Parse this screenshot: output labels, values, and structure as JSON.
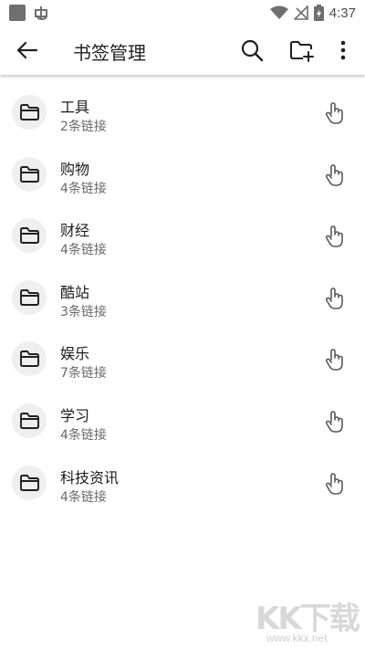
{
  "status_bar": {
    "time": "4:37"
  },
  "app_bar": {
    "title": "书签管理"
  },
  "folders": [
    {
      "name": "工具",
      "count": "2条链接"
    },
    {
      "name": "购物",
      "count": "4条链接"
    },
    {
      "name": "财经",
      "count": "4条链接"
    },
    {
      "name": "酷站",
      "count": "3条链接"
    },
    {
      "name": "娱乐",
      "count": "7条链接"
    },
    {
      "name": "学习",
      "count": "4条链接"
    },
    {
      "name": "科技资讯",
      "count": "4条链接"
    }
  ],
  "icons": {
    "back": "arrow-left-icon",
    "search": "search-icon",
    "new_folder": "folder-add-icon",
    "more": "more-vert-icon",
    "folder": "folder-icon",
    "open": "touch-hand-icon"
  },
  "watermark": {
    "brand": "KK下载",
    "url": "www.kkx.net"
  },
  "colors": {
    "background": "#ffffff",
    "icon": "#1f1f1f",
    "avatar_bg": "#efefef",
    "secondary_text": "#6a6a6a"
  }
}
